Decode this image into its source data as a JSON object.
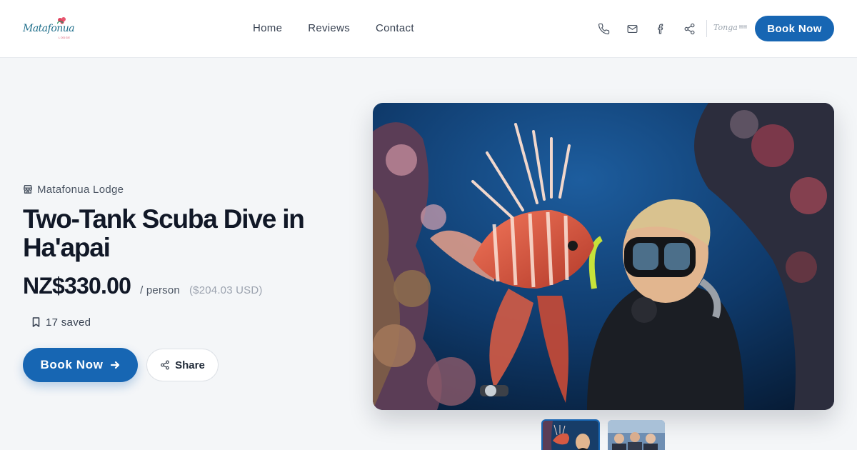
{
  "header": {
    "logo_text": "Matafonua",
    "logo_sub": "LODGE",
    "nav": [
      "Home",
      "Reviews",
      "Contact"
    ],
    "icons": [
      "phone-icon",
      "mail-icon",
      "facebook-icon",
      "share-icon"
    ],
    "partner_logo_text": "Tonga",
    "book_label": "Book Now"
  },
  "tour": {
    "vendor": "Matafonua Lodge",
    "title": "Two-Tank Scuba Dive in Ha'apai",
    "price": "NZ$330.00",
    "per": "/ person",
    "usd": "($204.03 USD)",
    "saved": "17 saved",
    "book_label": "Book Now",
    "share_label": "Share"
  },
  "colors": {
    "accent": "#1766b3",
    "title": "#111827",
    "muted": "#9ca3af"
  },
  "gallery": {
    "selected_index": 0,
    "count": 2
  }
}
